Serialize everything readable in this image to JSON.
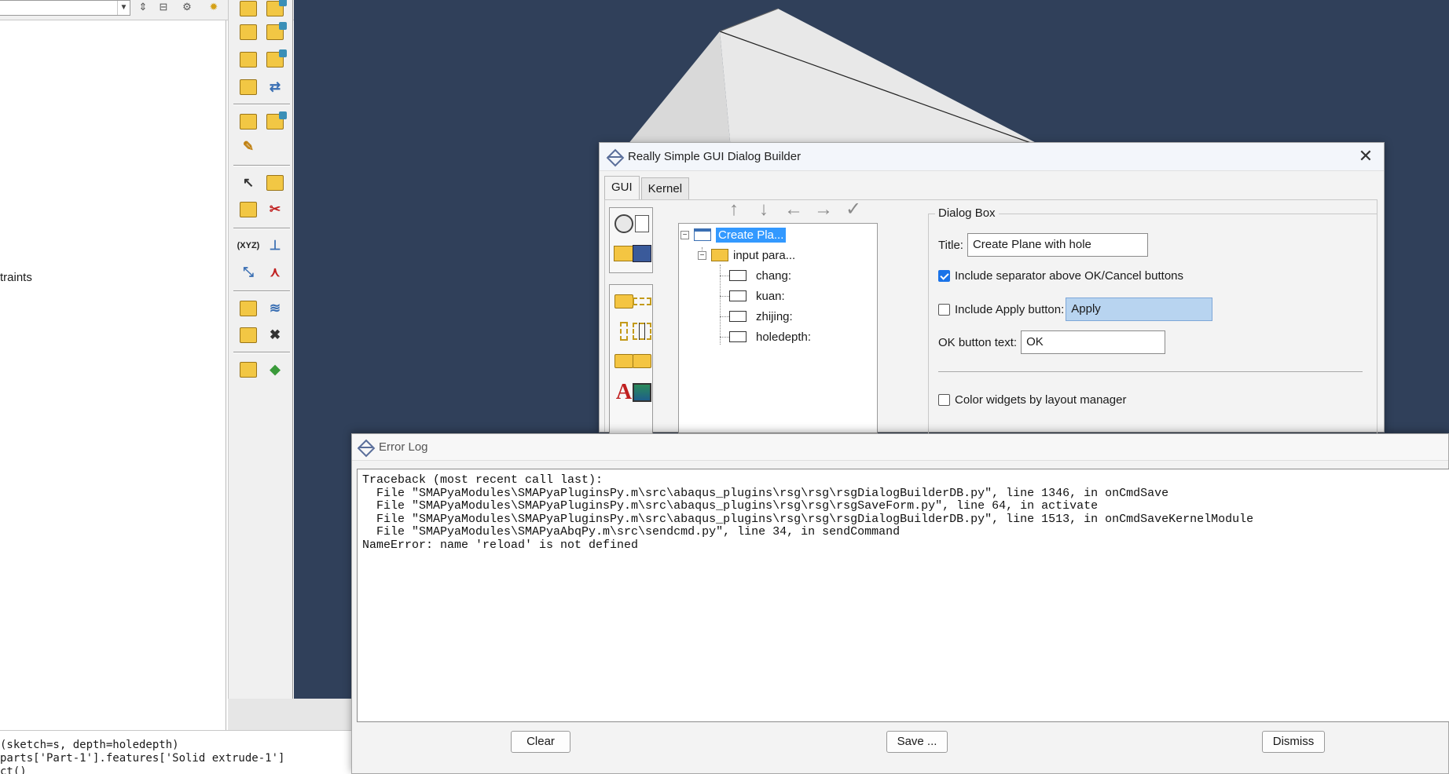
{
  "left_panel": {
    "label_constraints": "traints"
  },
  "message_area": {
    "lines": [
      "(sketch=s, depth=holedepth)",
      "parts['Part-1'].features['Solid extrude-1']",
      "ct()"
    ]
  },
  "rsg_dialog": {
    "title": "Really Simple GUI Dialog Builder",
    "close_label": "✕",
    "tabs": [
      {
        "label": "GUI"
      },
      {
        "label": "Kernel"
      }
    ],
    "arrows": {
      "up": "↑",
      "down": "↓",
      "left": "←",
      "right": "→",
      "check": "✓"
    },
    "tree": {
      "root_label": "Create Pla...",
      "group_label": "input para...",
      "items": [
        "chang:",
        "kuan:",
        "zhijing:",
        "holedepth:"
      ]
    },
    "dialog_box": {
      "group_label": "Dialog Box",
      "title_label": "Title:",
      "title_value": "Create Plane with hole",
      "include_separator_label": "Include separator above OK/Cancel buttons",
      "include_separator_checked": true,
      "include_apply_label": "Include Apply button:",
      "include_apply_checked": false,
      "apply_value": "Apply",
      "ok_label": "OK button text:",
      "ok_value": "OK",
      "color_widgets_label": "Color widgets by layout manager",
      "color_widgets_checked": false
    }
  },
  "error_log": {
    "title": "Error Log",
    "text": "Traceback (most recent call last):\n  File \"SMAPyaModules\\SMAPyaPluginsPy.m\\src\\abaqus_plugins\\rsg\\rsg\\rsgDialogBuilderDB.py\", line 1346, in onCmdSave\n  File \"SMAPyaModules\\SMAPyaPluginsPy.m\\src\\abaqus_plugins\\rsg\\rsg\\rsgSaveForm.py\", line 64, in activate\n  File \"SMAPyaModules\\SMAPyaPluginsPy.m\\src\\abaqus_plugins\\rsg\\rsg\\rsgDialogBuilderDB.py\", line 1513, in onCmdSaveKernelModule\n  File \"SMAPyaModules\\SMAPyaAbqPy.m\\src\\sendcmd.py\", line 34, in sendCommand\nNameError: name 'reload' is not defined",
    "buttons": {
      "clear": "Clear",
      "save": "Save ...",
      "dismiss": "Dismiss"
    }
  },
  "colors": {
    "viewport_bg": "#30405a",
    "selection": "#3399ff",
    "checkbox_checked": "#1a73e8",
    "apply_field_bg": "#b8d4f0",
    "part_face": "#e8e8e8"
  }
}
